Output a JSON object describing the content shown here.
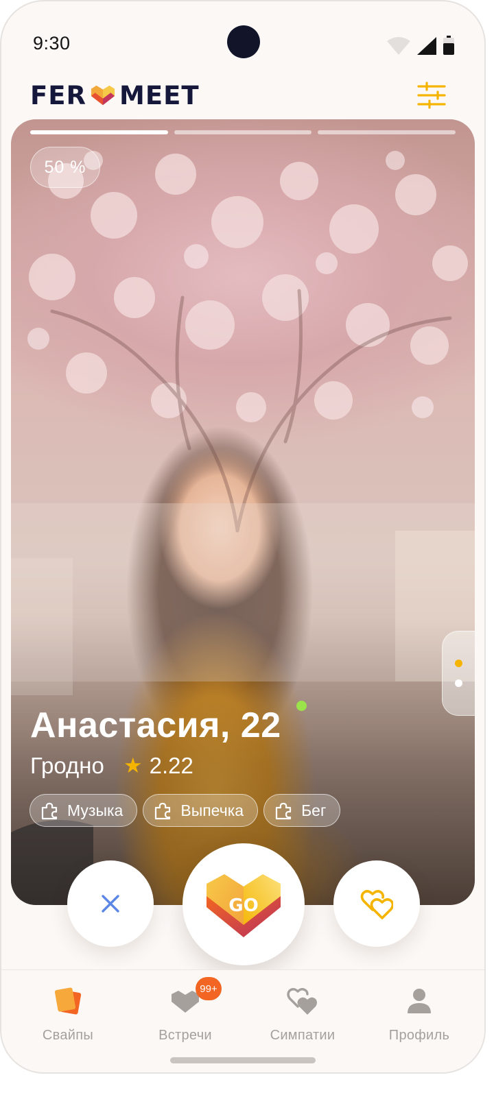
{
  "status_bar": {
    "time": "9:30"
  },
  "header": {
    "logo_left": "FER",
    "logo_right": "MEET",
    "logo_icon": "heart-box-logo-icon",
    "filter_icon": "sliders-icon"
  },
  "card": {
    "photo_pages": 3,
    "current_page": 1,
    "match_percent": "50 %",
    "name_age": "Анастасия, 22",
    "online": true,
    "city": "Гродно",
    "rating_icon": "★",
    "rating": "2.22",
    "interests": [
      {
        "label": "Музыка",
        "icon": "puzzle-icon"
      },
      {
        "label": "Выпечка",
        "icon": "puzzle-icon"
      },
      {
        "label": "Бег",
        "icon": "puzzle-icon"
      }
    ],
    "side_pager_active": 1
  },
  "actions": {
    "dislike_icon": "close-icon",
    "go_label": "GO",
    "like_icon": "hearts-icon"
  },
  "bottom_nav": {
    "items": [
      {
        "label": "Свайпы",
        "icon": "cards-icon",
        "active": true
      },
      {
        "label": "Встречи",
        "icon": "heart-icon",
        "badge": "99+"
      },
      {
        "label": "Симпатии",
        "icon": "double-heart-icon"
      },
      {
        "label": "Профиль",
        "icon": "user-icon"
      }
    ]
  },
  "colors": {
    "accent": "#f5b400",
    "brand_orange": "#f26522",
    "brand_navy": "#15183a",
    "online": "#9be34a",
    "dislike": "#5b86e5"
  }
}
